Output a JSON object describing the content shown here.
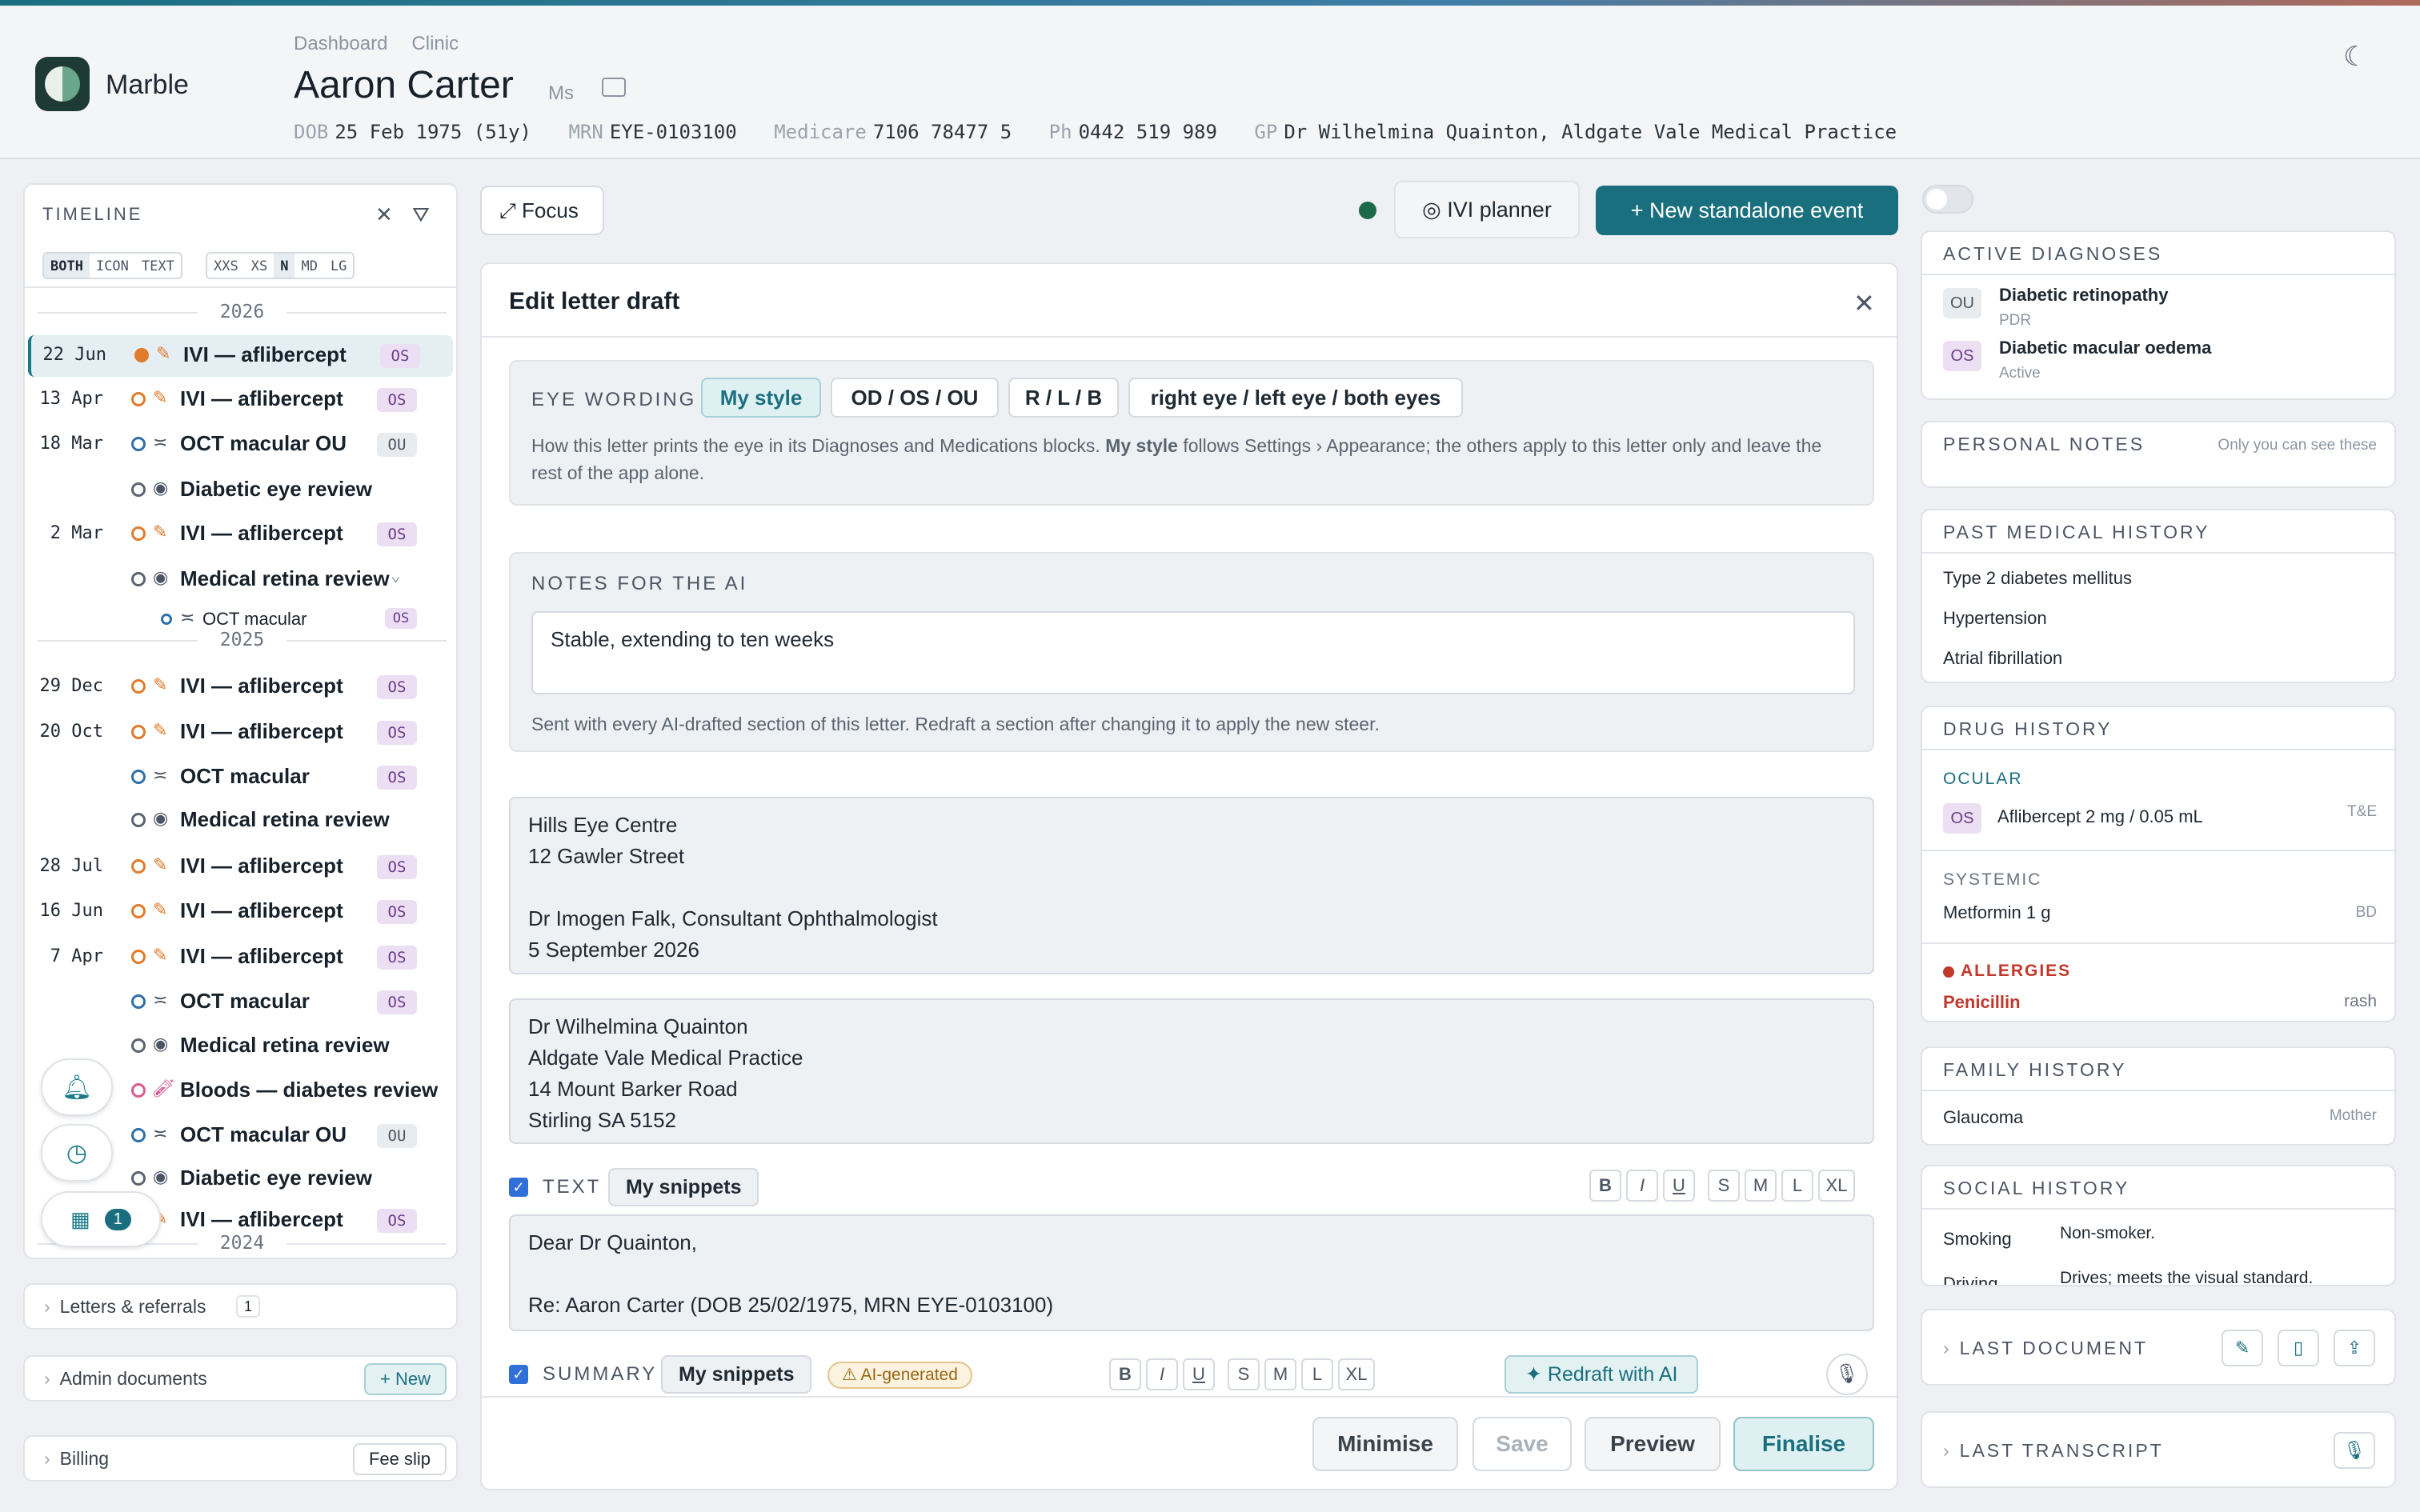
{
  "app": {
    "name": "Marble"
  },
  "breadcrumb": [
    "Dashboard",
    "Clinic"
  ],
  "patient": {
    "name": "Aaron Carter",
    "title": "Ms",
    "meta": [
      {
        "k": "DOB",
        "v": "25 Feb 1975 (51y)"
      },
      {
        "k": "MRN",
        "v": "EYE-0103100"
      },
      {
        "k": "Medicare",
        "v": "7106 78477 5"
      },
      {
        "k": "Ph",
        "v": "0442 519 989"
      },
      {
        "k": "GP",
        "v": "Dr Wilhelmina Quainton, Aldgate Vale Medical Practice"
      }
    ]
  },
  "timeline": {
    "title": "TIMELINE",
    "mode": [
      "BOTH",
      "ICON",
      "TEXT"
    ],
    "size": [
      "XXS",
      "XS",
      "N",
      "MD",
      "LG"
    ],
    "years": [
      "2026",
      "2025",
      "2024"
    ],
    "rows": [
      {
        "date": "22 Jun",
        "label": "IVI — aflibercept",
        "badge": "OS"
      },
      {
        "date": "13 Apr",
        "label": "IVI — aflibercept",
        "badge": "OS"
      },
      {
        "date": "18 Mar",
        "label": "OCT macular OU",
        "badge": "OU"
      },
      {
        "date": "",
        "label": "Diabetic eye review",
        "badge": ""
      },
      {
        "date": "2 Mar",
        "label": "IVI — aflibercept",
        "badge": "OS"
      },
      {
        "date": "",
        "label": "Medical retina review",
        "badge": "⌄"
      },
      {
        "date": "",
        "label": "OCT macular",
        "badge": "OS"
      },
      {
        "date": "29 Dec",
        "label": "IVI — aflibercept",
        "badge": "OS"
      },
      {
        "date": "20 Oct",
        "label": "IVI — aflibercept",
        "badge": "OS"
      },
      {
        "date": "",
        "label": "OCT macular",
        "badge": "OS"
      },
      {
        "date": "",
        "label": "Medical retina review",
        "badge": ""
      },
      {
        "date": "28 Jul",
        "label": "IVI — aflibercept",
        "badge": "OS"
      },
      {
        "date": "16 Jun",
        "label": "IVI — aflibercept",
        "badge": "OS"
      },
      {
        "date": "7 Apr",
        "label": "IVI — aflibercept",
        "badge": "OS"
      },
      {
        "date": "",
        "label": "OCT macular",
        "badge": "OS"
      },
      {
        "date": "",
        "label": "Medical retina review",
        "badge": ""
      },
      {
        "date": "",
        "label": "Bloods — diabetes review",
        "badge": ""
      },
      {
        "date": "",
        "label": "OCT macular OU",
        "badge": "OU"
      },
      {
        "date": "",
        "label": "Diabetic eye review",
        "badge": ""
      },
      {
        "date": "",
        "label": "IVI — aflibercept",
        "badge": "OS"
      }
    ],
    "calendar_count": "1"
  },
  "left_sections": {
    "letters": "Letters & referrals",
    "letters_count": "1",
    "admin": "Admin documents",
    "admin_btn": "+ New",
    "billing": "Billing",
    "billing_btn": "Fee slip"
  },
  "toolbar": {
    "focus": "⤢ Focus",
    "ivi_planner": "◎ IVI planner",
    "new_event": "+ New standalone event"
  },
  "modal": {
    "title": "Edit letter draft",
    "eye_wording": {
      "label": "EYE WORDING",
      "options": [
        "My style",
        "OD / OS / OU",
        "R / L / B",
        "right eye / left eye / both eyes"
      ],
      "help_pre": "How this letter prints the eye in its Diagnoses and Medications blocks. ",
      "help_bold": "My style",
      "help_post": " follows Settings › Appearance; the others apply to this letter only and leave the rest of the app alone."
    },
    "notes": {
      "label": "NOTES FOR THE AI",
      "value": "Stable, extending to ten weeks",
      "help": "Sent with every AI-drafted section of this letter. Redraft a section after changing it to apply the new steer."
    },
    "from_block": "Hills Eye Centre\n12 Gawler Street\n\nDr Imogen Falk, Consultant Ophthalmologist\n5 September 2026",
    "to_block": "Dr Wilhelmina Quainton\nAldgate Vale Medical Practice\n14 Mount Barker Road\nStirling SA 5152",
    "text_section": {
      "label": "TEXT",
      "snippets": "My snippets",
      "value": "Dear Dr Quainton,\n\nRe: Aaron Carter (DOB 25/02/1975, MRN EYE-0103100)"
    },
    "format_buttons": [
      "B",
      "I",
      "U",
      "S",
      "M",
      "L",
      "XL"
    ],
    "summary_section": {
      "label": "SUMMARY",
      "snippets": "My snippets",
      "badge": "⚠ AI-generated",
      "redraft": "✦ Redraft with AI"
    },
    "footer": {
      "minimise": "Minimise",
      "save": "Save",
      "preview": "Preview",
      "finalise": "Finalise"
    }
  },
  "right": {
    "active_diagnoses": {
      "title": "ACTIVE DIAGNOSES",
      "items": [
        {
          "eye": "OU",
          "name": "Diabetic retinopathy",
          "sub": "PDR"
        },
        {
          "eye": "OS",
          "name": "Diabetic macular oedema",
          "sub": "Active"
        }
      ]
    },
    "personal_notes": {
      "title": "PERSONAL NOTES",
      "hint": "Only you can see these"
    },
    "pmh": {
      "title": "PAST MEDICAL HISTORY",
      "items": [
        "Type 2 diabetes mellitus",
        "Hypertension",
        "Atrial fibrillation"
      ]
    },
    "drugs": {
      "title": "DRUG HISTORY",
      "ocular_label": "OCULAR",
      "ocular": {
        "eye": "OS",
        "name": "Aflibercept 2 mg / 0.05 mL",
        "regimen": "T&E"
      },
      "systemic_label": "SYSTEMIC",
      "systemic": {
        "name": "Metformin 1 g",
        "freq": "BD"
      },
      "allergies_label": "ALLERGIES",
      "allergy": {
        "name": "Penicillin",
        "reaction": "rash"
      }
    },
    "family": {
      "title": "FAMILY HISTORY",
      "item": "Glaucoma",
      "rel": "Mother"
    },
    "social": {
      "title": "SOCIAL HISTORY",
      "rows": [
        {
          "k": "Smoking",
          "v": "Non-smoker."
        },
        {
          "k": "Driving",
          "v": "Drives; meets the visual standard."
        }
      ]
    },
    "last_document": "LAST DOCUMENT",
    "last_transcript": "LAST TRANSCRIPT"
  },
  "colors": {
    "accent": "#1a6f7e",
    "injection": "#e07b2b",
    "allergy": "#c0392b",
    "os_badge": "#ecdff3"
  }
}
